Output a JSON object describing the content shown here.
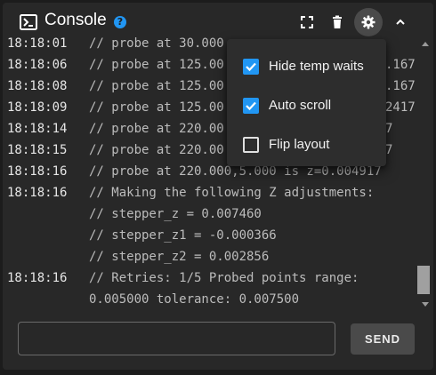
{
  "header": {
    "title": "Console",
    "help_icon": "help-circle-icon",
    "buttons": [
      {
        "name": "expand-icon"
      },
      {
        "name": "trash-icon"
      },
      {
        "name": "gear-icon",
        "active": true
      },
      {
        "name": "chevron-up-icon"
      }
    ]
  },
  "log": [
    {
      "time": "18:18:01",
      "msg": "// probe at 30.000"
    },
    {
      "time": "18:18:06",
      "msg": "// probe at 125.00"
    },
    {
      "time": "18:18:08",
      "msg": "// probe at 125.00"
    },
    {
      "time": "18:18:09",
      "msg": "// probe at 125.00"
    },
    {
      "time": "18:18:14",
      "msg": "// probe at 220.00"
    },
    {
      "time": "18:18:15",
      "msg": "// probe at 220.00"
    },
    {
      "time": "18:18:16",
      "msg": "// probe at 220.000,5.000 is z=0.004917"
    },
    {
      "time": "18:18:16",
      "msg": "// Making the following Z adjustments:"
    },
    {
      "time": "",
      "msg": "// stepper_z = 0.007460"
    },
    {
      "time": "",
      "msg": "// stepper_z1 = -0.000366"
    },
    {
      "time": "",
      "msg": "// stepper_z2 = 0.002856"
    },
    {
      "time": "18:18:16",
      "msg": "// Retries: 1/5 Probed points range:"
    },
    {
      "time": "",
      "msg": "0.005000 tolerance: 0.007500"
    }
  ],
  "log_partial_right": [
    {
      "text": ".167"
    },
    {
      "text": ".167"
    },
    {
      "text": "2417"
    },
    {
      "text": "7"
    },
    {
      "text": "7"
    }
  ],
  "menu": {
    "items": [
      {
        "label": "Hide temp waits",
        "checked": true
      },
      {
        "label": "Auto scroll",
        "checked": true
      },
      {
        "label": "Flip layout",
        "checked": false
      }
    ]
  },
  "input": {
    "value": "",
    "placeholder": ""
  },
  "send_label": "SEND",
  "colors": {
    "accent": "#2196f3",
    "card_bg": "#282828",
    "page_bg": "#1c1c1c",
    "menu_bg": "#2d2d2d",
    "send_bg": "#4a4a4a"
  }
}
